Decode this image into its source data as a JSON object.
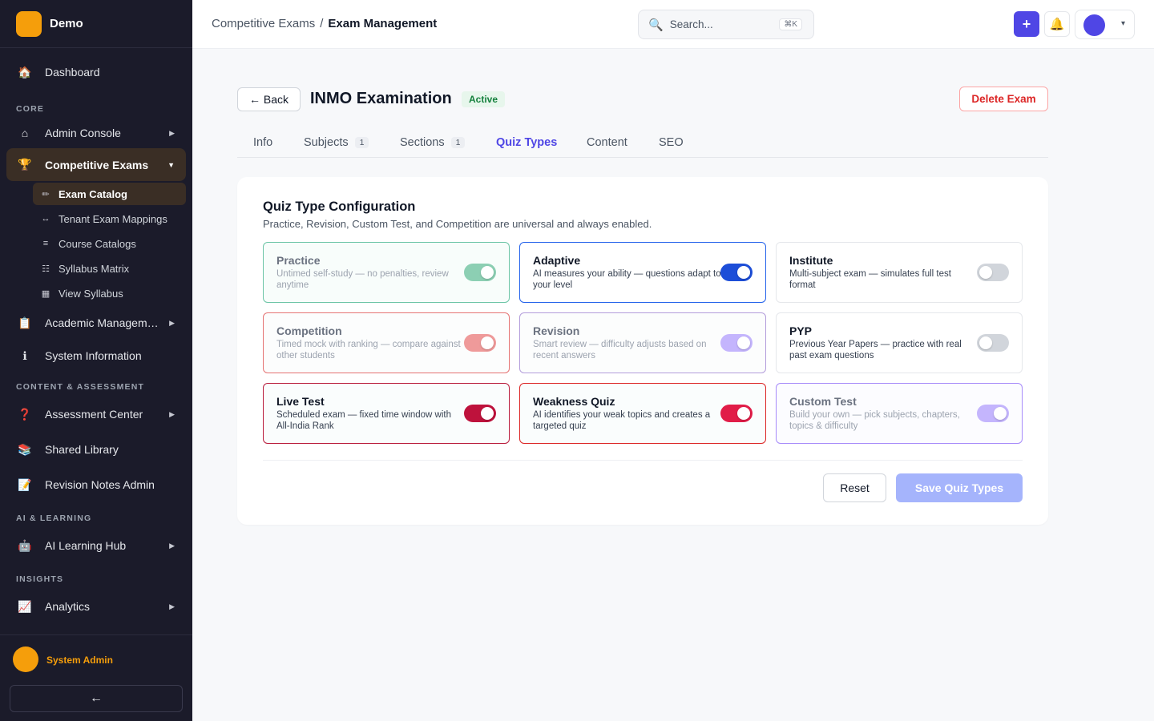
{
  "brand": {
    "name": "Demo"
  },
  "sidebar": {
    "dashboard": {
      "icon": "🏠",
      "label": "Dashboard"
    },
    "section_core": "CORE",
    "admin_console": {
      "icon": "⌂",
      "label": "Admin Console"
    },
    "competitive_exams": {
      "icon": "🏆",
      "label": "Competitive Exams"
    },
    "sub_items": [
      {
        "icon": "✏",
        "label": "Exam Catalog"
      },
      {
        "icon": "↔",
        "label": "Tenant Exam Mappings"
      },
      {
        "icon": "≡",
        "label": "Course Catalogs"
      },
      {
        "icon": "☷",
        "label": "Syllabus Matrix"
      },
      {
        "icon": "▦",
        "label": "View Syllabus"
      }
    ],
    "academic": {
      "icon": "📋",
      "label": "Academic Management"
    },
    "system_info": {
      "icon": "ℹ",
      "label": "System Information"
    },
    "section_content": "CONTENT & ASSESSMENT",
    "assessment": {
      "icon": "❓",
      "label": "Assessment Center"
    },
    "shared_library": {
      "icon": "📚",
      "label": "Shared Library"
    },
    "revision_notes": {
      "icon": "📝",
      "label": "Revision Notes Admin"
    },
    "section_ai": "AI & LEARNING",
    "ai_hub": {
      "icon": "🤖",
      "label": "AI Learning Hub"
    },
    "section_insights": "INSIGHTS",
    "analytics": {
      "icon": "📈",
      "label": "Analytics"
    },
    "admin_name": "System Admin",
    "collapse_icon": "←"
  },
  "topbar": {
    "breadcrumb_parent": "Competitive Exams",
    "breadcrumb_sep": "/",
    "breadcrumb_current": "Exam Management",
    "search_icon": "🔍",
    "search_placeholder": "Search...",
    "search_shortcut": "⌘K",
    "plus_icon": "+",
    "bell_icon": "🔔",
    "user_caret": "▾"
  },
  "exam": {
    "back_label": "← Back",
    "title": "INMO Examination",
    "status": "Active",
    "delete_label": "Delete Exam"
  },
  "tabs": [
    {
      "label": "Info",
      "count": ""
    },
    {
      "label": "Subjects",
      "count": "1"
    },
    {
      "label": "Sections",
      "count": "1"
    },
    {
      "label": "Quiz Types",
      "count": ""
    },
    {
      "label": "Content",
      "count": ""
    },
    {
      "label": "SEO",
      "count": ""
    }
  ],
  "active_tab": "Quiz Types",
  "config": {
    "title": "Quiz Type Configuration",
    "subtitle": "Practice, Revision, Custom Test, and Competition are universal and always enabled.",
    "quiz_types": [
      {
        "name": "Practice",
        "desc": "Untimed self-study — no penalties, review anytime",
        "enabled": true,
        "locked": true,
        "border": "#6cc5a6",
        "bg": "#f8fdfb",
        "toggle_color": "#8ccfb3"
      },
      {
        "name": "Adaptive",
        "desc": "AI measures your ability — questions adapt to your level",
        "enabled": true,
        "locked": false,
        "border": "#2563eb",
        "bg": "#ffffff",
        "toggle_color": "#1d4ed8"
      },
      {
        "name": "Institute",
        "desc": "Multi-subject exam — simulates full test format",
        "enabled": false,
        "locked": false,
        "border": "#e5e7eb",
        "bg": "#ffffff",
        "toggle_color": "#d1d5db"
      },
      {
        "name": "Competition",
        "desc": "Timed mock with ranking — compare against other students",
        "enabled": true,
        "locked": true,
        "border": "#e57373",
        "bg": "#fcfdfd",
        "toggle_color": "#ef9a9a"
      },
      {
        "name": "Revision",
        "desc": "Smart review — difficulty adjusts based on recent answers",
        "enabled": true,
        "locked": true,
        "border": "#b39ddb",
        "bg": "#fcfdfd",
        "toggle_color": "#c4b5fd"
      },
      {
        "name": "PYP",
        "desc": "Previous Year Papers — practice with real past exam questions",
        "enabled": false,
        "locked": false,
        "border": "#e5e7eb",
        "bg": "#ffffff",
        "toggle_color": "#d1d5db"
      },
      {
        "name": "Live Test",
        "desc": "Scheduled exam — fixed time window with All-India Rank",
        "enabled": true,
        "locked": false,
        "border": "#b91c3c",
        "bg": "#fafdfd",
        "toggle_color": "#be123c"
      },
      {
        "name": "Weakness Quiz",
        "desc": "AI identifies your weak topics and creates a targeted quiz",
        "enabled": true,
        "locked": false,
        "border": "#dc2626",
        "bg": "#fafdfd",
        "toggle_color": "#e11d48"
      },
      {
        "name": "Custom Test",
        "desc": "Build your own — pick subjects, chapters, topics & difficulty",
        "enabled": true,
        "locked": true,
        "border": "#a78bfa",
        "bg": "#fcfcff",
        "toggle_color": "#c4b5fd"
      }
    ],
    "reset_label": "Reset",
    "save_label": "Save Quiz Types"
  }
}
